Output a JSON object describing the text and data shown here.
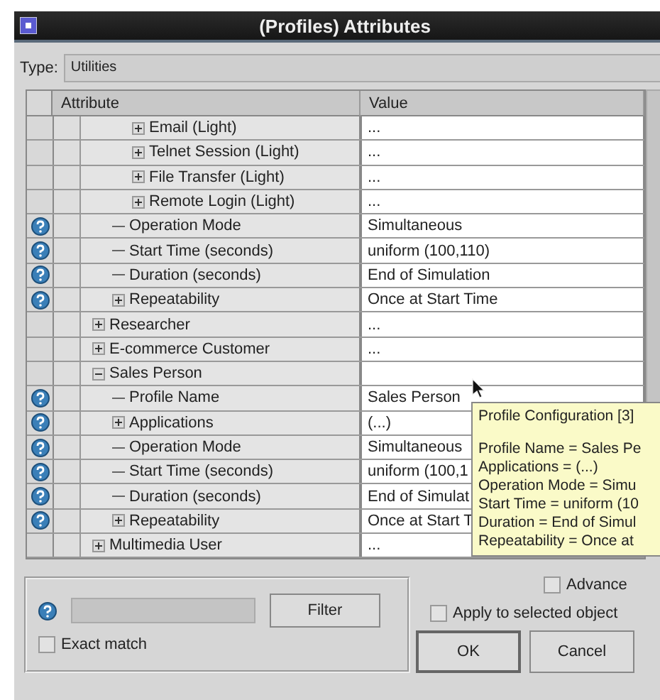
{
  "window": {
    "title": "(Profiles) Attributes"
  },
  "type_field": {
    "label": "Type:",
    "value": "Utilities"
  },
  "table": {
    "columns": [
      "Attribute",
      "Value"
    ],
    "rows": [
      {
        "kind": "hidden",
        "children": [
          {
            "kind": "hidden",
            "children": [
              {
                "attribute": "Email (Light)",
                "value": "...",
                "help": false,
                "kind": "plus"
              },
              {
                "attribute": "Telnet Session (Light)",
                "value": "...",
                "help": false,
                "kind": "plus"
              },
              {
                "attribute": "File Transfer (Light)",
                "value": "...",
                "help": false,
                "kind": "plus"
              },
              {
                "attribute": "Remote Login (Light)",
                "value": "...",
                "help": false,
                "kind": "plus"
              }
            ]
          },
          {
            "attribute": "Operation Mode",
            "value": "Simultaneous",
            "help": true,
            "kind": "leaf"
          },
          {
            "attribute": "Start Time (seconds)",
            "value": "uniform (100,110)",
            "help": true,
            "kind": "leaf"
          },
          {
            "attribute": "Duration (seconds)",
            "value": "End of Simulation",
            "help": true,
            "kind": "leaf"
          },
          {
            "attribute": "Repeatability",
            "value": "Once at Start Time",
            "help": true,
            "kind": "plus"
          }
        ]
      },
      {
        "attribute": "Researcher",
        "value": "...",
        "help": false,
        "kind": "plus"
      },
      {
        "attribute": "E-commerce Customer",
        "value": "...",
        "help": false,
        "kind": "plus"
      },
      {
        "attribute": "Sales Person",
        "help": false,
        "kind": "minus",
        "children": [
          {
            "attribute": "Profile Name",
            "value": "Sales Person",
            "help": true,
            "kind": "leaf"
          },
          {
            "attribute": "Applications",
            "value": "(...)",
            "help": true,
            "kind": "plus"
          },
          {
            "attribute": "Operation Mode",
            "value": "Simultaneous",
            "help": true,
            "kind": "leaf"
          },
          {
            "attribute": "Start Time (seconds)",
            "value": "uniform (100,1",
            "help": true,
            "kind": "leaf"
          },
          {
            "attribute": "Duration (seconds)",
            "value": "End of Simulat",
            "help": true,
            "kind": "leaf"
          },
          {
            "attribute": "Repeatability",
            "value": "Once at Start T",
            "help": true,
            "kind": "plus"
          }
        ]
      },
      {
        "attribute": "Multimedia User",
        "value": "...",
        "help": false,
        "kind": "plus"
      }
    ]
  },
  "tooltip": {
    "title": "Profile Configuration [3]",
    "lines": [
      "Profile Name = Sales Pe",
      "Applications = (...)",
      "Operation Mode = Simu",
      "Start Time = uniform (10",
      "Duration = End of Simul",
      "Repeatability = Once at"
    ]
  },
  "filter": {
    "button": "Filter",
    "exact_match": {
      "label": "Exact match",
      "checked": false
    }
  },
  "options": [
    {
      "label": "Advance",
      "checked": false
    },
    {
      "label": "Apply to selected object",
      "checked": false
    }
  ],
  "buttons": [
    "OK",
    "Cancel"
  ]
}
